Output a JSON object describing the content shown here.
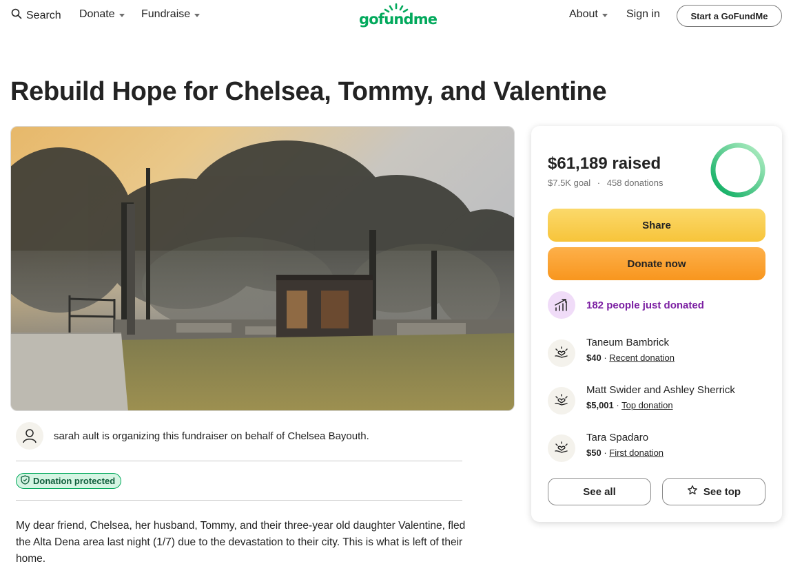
{
  "nav": {
    "search_label": "Search",
    "donate_label": "Donate",
    "fundraise_label": "Fundraise",
    "logo_text": "gofundme",
    "about_label": "About",
    "signin_label": "Sign in",
    "start_label": "Start a GoFundMe"
  },
  "campaign": {
    "title": "Rebuild Hope for Chelsea, Tommy, and Valentine",
    "organizer_text": "sarah ault is organizing this fundraiser on behalf of Chelsea Bayouth.",
    "protected_label": "Donation protected",
    "story": "My dear friend, Chelsea, her husband, Tommy, and their three-year old daughter Valentine, fled the Alta Dena area last night (1/7) due to the devastation to their city. This is what is left of their home."
  },
  "card": {
    "raised": "$61,189 raised",
    "goal": "$7.5K goal",
    "separator": "·",
    "donations": "458 donations",
    "progress_fraction": 1.0,
    "share_label": "Share",
    "donate_label": "Donate now",
    "momentum": "182 people just donated",
    "donors": [
      {
        "name": "Taneum Bambrick",
        "amount": "$40",
        "sep": " · ",
        "tag": "Recent donation"
      },
      {
        "name": "Matt Swider and Ashley Sherrick",
        "amount": "$5,001",
        "sep": " · ",
        "tag": "Top donation"
      },
      {
        "name": "Tara Spadaro",
        "amount": "$50",
        "sep": " · ",
        "tag": "First donation"
      }
    ],
    "see_all_label": "See all",
    "see_top_label": "See top"
  },
  "colors": {
    "brand_green": "#02a95c",
    "share_yellow": "#f7c43a",
    "donate_orange": "#f8961e",
    "momentum_purple": "#7b1fa2"
  },
  "icons": {
    "search": "search-icon",
    "organizer": "user-icon",
    "protected": "shield-icon",
    "momentum": "trending-up-icon",
    "donor": "heart-hand-icon",
    "see_top": "star-icon"
  }
}
